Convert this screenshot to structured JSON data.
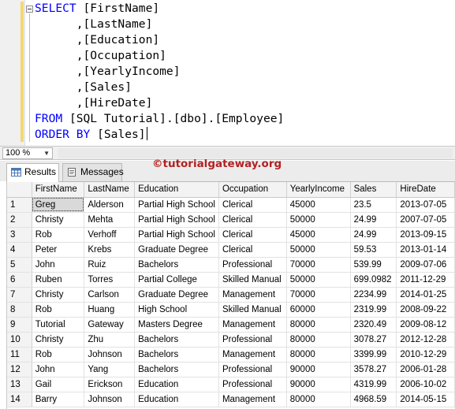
{
  "editor": {
    "lines": [
      {
        "kw": "SELECT",
        "text": " [FirstName]"
      },
      {
        "kw": "",
        "text": "      ,[LastName]"
      },
      {
        "kw": "",
        "text": "      ,[Education]"
      },
      {
        "kw": "",
        "text": "      ,[Occupation]"
      },
      {
        "kw": "",
        "text": "      ,[YearlyIncome]"
      },
      {
        "kw": "",
        "text": "      ,[Sales]"
      },
      {
        "kw": "",
        "text": "      ,[HireDate]"
      },
      {
        "kw": "FROM",
        "text": " [SQL Tutorial].[dbo].[Employee]"
      },
      {
        "kw": "ORDER BY",
        "text": " [Sales]"
      }
    ]
  },
  "zoom": {
    "value": "100 %"
  },
  "tabs": {
    "results": "Results",
    "messages": "Messages"
  },
  "watermark": "©tutorialgateway.org",
  "colors": {
    "keyword": "#0000ff",
    "watermark": "#b22222",
    "selected_cell": "#d9d9d9"
  },
  "grid": {
    "columns": [
      "FirstName",
      "LastName",
      "Education",
      "Occupation",
      "YearlyIncome",
      "Sales",
      "HireDate"
    ],
    "rows": [
      [
        "1",
        "Greg",
        "Alderson",
        "Partial High School",
        "Clerical",
        "45000",
        "23.5",
        "2013-07-05"
      ],
      [
        "2",
        "Christy",
        "Mehta",
        "Partial High School",
        "Clerical",
        "50000",
        "24.99",
        "2007-07-05"
      ],
      [
        "3",
        "Rob",
        "Verhoff",
        "Partial High School",
        "Clerical",
        "45000",
        "24.99",
        "2013-09-15"
      ],
      [
        "4",
        "Peter",
        "Krebs",
        "Graduate Degree",
        "Clerical",
        "50000",
        "59.53",
        "2013-01-14"
      ],
      [
        "5",
        "John",
        "Ruiz",
        "Bachelors",
        "Professional",
        "70000",
        "539.99",
        "2009-07-06"
      ],
      [
        "6",
        "Ruben",
        "Torres",
        "Partial College",
        "Skilled Manual",
        "50000",
        "699.0982",
        "2011-12-29"
      ],
      [
        "7",
        "Christy",
        "Carlson",
        "Graduate Degree",
        "Management",
        "70000",
        "2234.99",
        "2014-01-25"
      ],
      [
        "8",
        "Rob",
        "Huang",
        "High School",
        "Skilled Manual",
        "60000",
        "2319.99",
        "2008-09-22"
      ],
      [
        "9",
        "Tutorial",
        "Gateway",
        "Masters Degree",
        "Management",
        "80000",
        "2320.49",
        "2009-08-12"
      ],
      [
        "10",
        "Christy",
        "Zhu",
        "Bachelors",
        "Professional",
        "80000",
        "3078.27",
        "2012-12-28"
      ],
      [
        "11",
        "Rob",
        "Johnson",
        "Bachelors",
        "Management",
        "80000",
        "3399.99",
        "2010-12-29"
      ],
      [
        "12",
        "John",
        "Yang",
        "Bachelors",
        "Professional",
        "90000",
        "3578.27",
        "2006-01-28"
      ],
      [
        "13",
        "Gail",
        "Erickson",
        "Education",
        "Professional",
        "90000",
        "4319.99",
        "2006-10-02"
      ],
      [
        "14",
        "Barry",
        "Johnson",
        "Education",
        "Management",
        "80000",
        "4968.59",
        "2014-05-15"
      ]
    ]
  }
}
